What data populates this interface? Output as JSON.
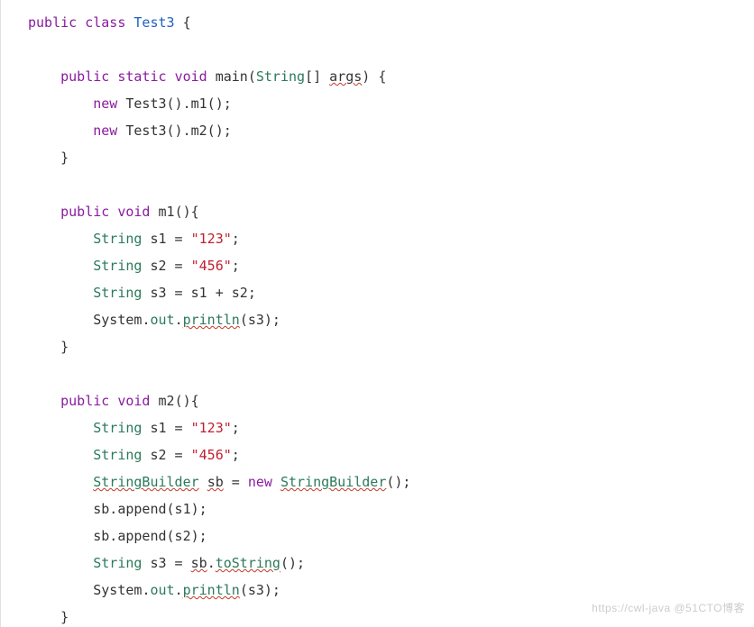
{
  "code": {
    "line1": {
      "kw_public": "public",
      "kw_class": "class",
      "cls": "Test3",
      "brace": "{"
    },
    "main": {
      "kw_public": "public",
      "kw_static": "static",
      "kw_void": "void",
      "name": "main",
      "param_type": "String",
      "param_arr": "[]",
      "param_name": "args",
      "brace": "{",
      "stmt1": {
        "kw_new": "new",
        "call": "Test3",
        "tail": "().m1();"
      },
      "stmt2": {
        "kw_new": "new",
        "call": "Test3",
        "tail": "().m2();"
      },
      "close": "}"
    },
    "m1": {
      "kw_public": "public",
      "kw_void": "void",
      "name": "m1",
      "paren": "(){",
      "s1": {
        "type": "String",
        "var": "s1",
        "eq": " = ",
        "val": "\"123\"",
        "semi": ";"
      },
      "s2": {
        "type": "String",
        "var": "s2",
        "eq": " = ",
        "val": "\"456\"",
        "semi": ";"
      },
      "s3": {
        "type": "String",
        "var": "s3",
        "eq": " = s1 + s2;",
        "semi": ""
      },
      "print": {
        "sys": "System",
        "dot1": ".",
        "out": "out",
        "dot2": ".",
        "pln": "println",
        "arg": "(s3);"
      },
      "close": "}"
    },
    "m2": {
      "kw_public": "public",
      "kw_void": "void",
      "name": "m2",
      "paren": "(){",
      "s1": {
        "type": "String",
        "var": "s1",
        "eq": " = ",
        "val": "\"123\"",
        "semi": ";"
      },
      "s2": {
        "type": "String",
        "var": "s2",
        "eq": " = ",
        "val": "\"456\"",
        "semi": ";"
      },
      "sb_decl": {
        "type": "StringBuilder",
        "var": "sb",
        "eq": " = ",
        "kw_new": "new",
        "ctor": "StringBuilder",
        "tail": "();"
      },
      "app1": "sb.append(s1);",
      "app2": "sb.append(s2);",
      "s3": {
        "type": "String",
        "var": "s3",
        "eq": " = ",
        "sbvar": "sb",
        "dot": ".",
        "tostr": "toString",
        "tail": "();"
      },
      "print": {
        "sys": "System",
        "dot1": ".",
        "out": "out",
        "dot2": ".",
        "pln": "println",
        "arg": "(s3);"
      },
      "close": "}"
    }
  },
  "watermark": "https://cwl-java   @51CTO博客"
}
